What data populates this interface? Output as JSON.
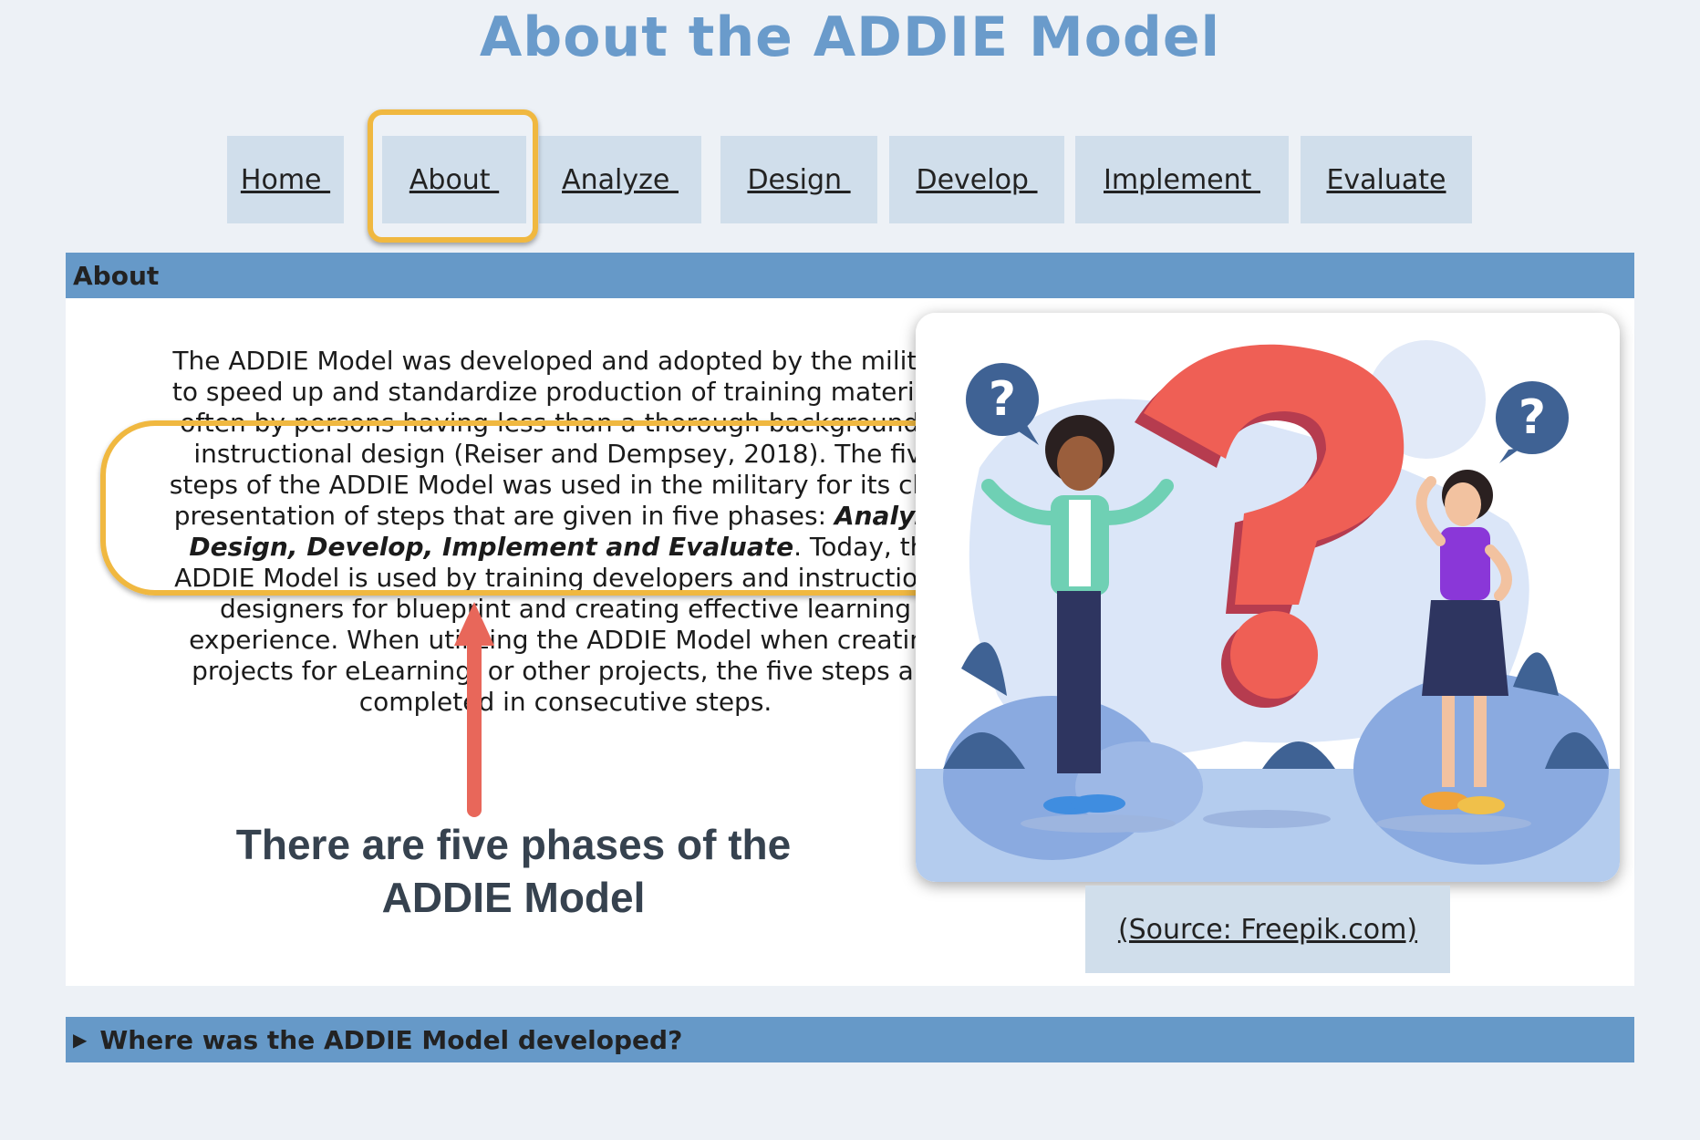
{
  "page": {
    "title": "About the ADDIE Model"
  },
  "nav": {
    "items": [
      {
        "label": "Home "
      },
      {
        "label": "About "
      },
      {
        "label": "Analyze "
      },
      {
        "label": "Design "
      },
      {
        "label": "Develop "
      },
      {
        "label": "Implement "
      },
      {
        "label": "Evaluate"
      }
    ],
    "active": "About"
  },
  "about_section": {
    "header": "About",
    "text_1": "The ADDIE Model was developed and adopted by the military to speed up and standardize production of training materials, often by persons having less than a thorough background in instructional design (Reiser and Dempsey, 2018). The five steps of the ADDIE Model was used in the military for its clear presentation of steps that are given in five phases: ",
    "phases": "Analyze, Design, Develop, Implement and Evaluate",
    "text_2": ". Today, the ADDIE Model is used by training developers and instructional designers for blueprint and creating effective learning experience. When utilizing the ADDIE Model when creating projects for eLearning, or other projects, the five steps are completed in consecutive steps.",
    "annotation_caption": "There are five phases of the ADDIE Model",
    "image_source_label": "(Source: Freepik.com)",
    "question_mark_bubble": "?"
  },
  "accordion": {
    "label": "Where was the ADDIE Model developed?"
  },
  "colors": {
    "title": "#6a9bcb",
    "section_bar": "#6699c8",
    "nav_bg": "#d0deeb",
    "highlight": "#f0b840",
    "arrow": "#e8675a"
  }
}
